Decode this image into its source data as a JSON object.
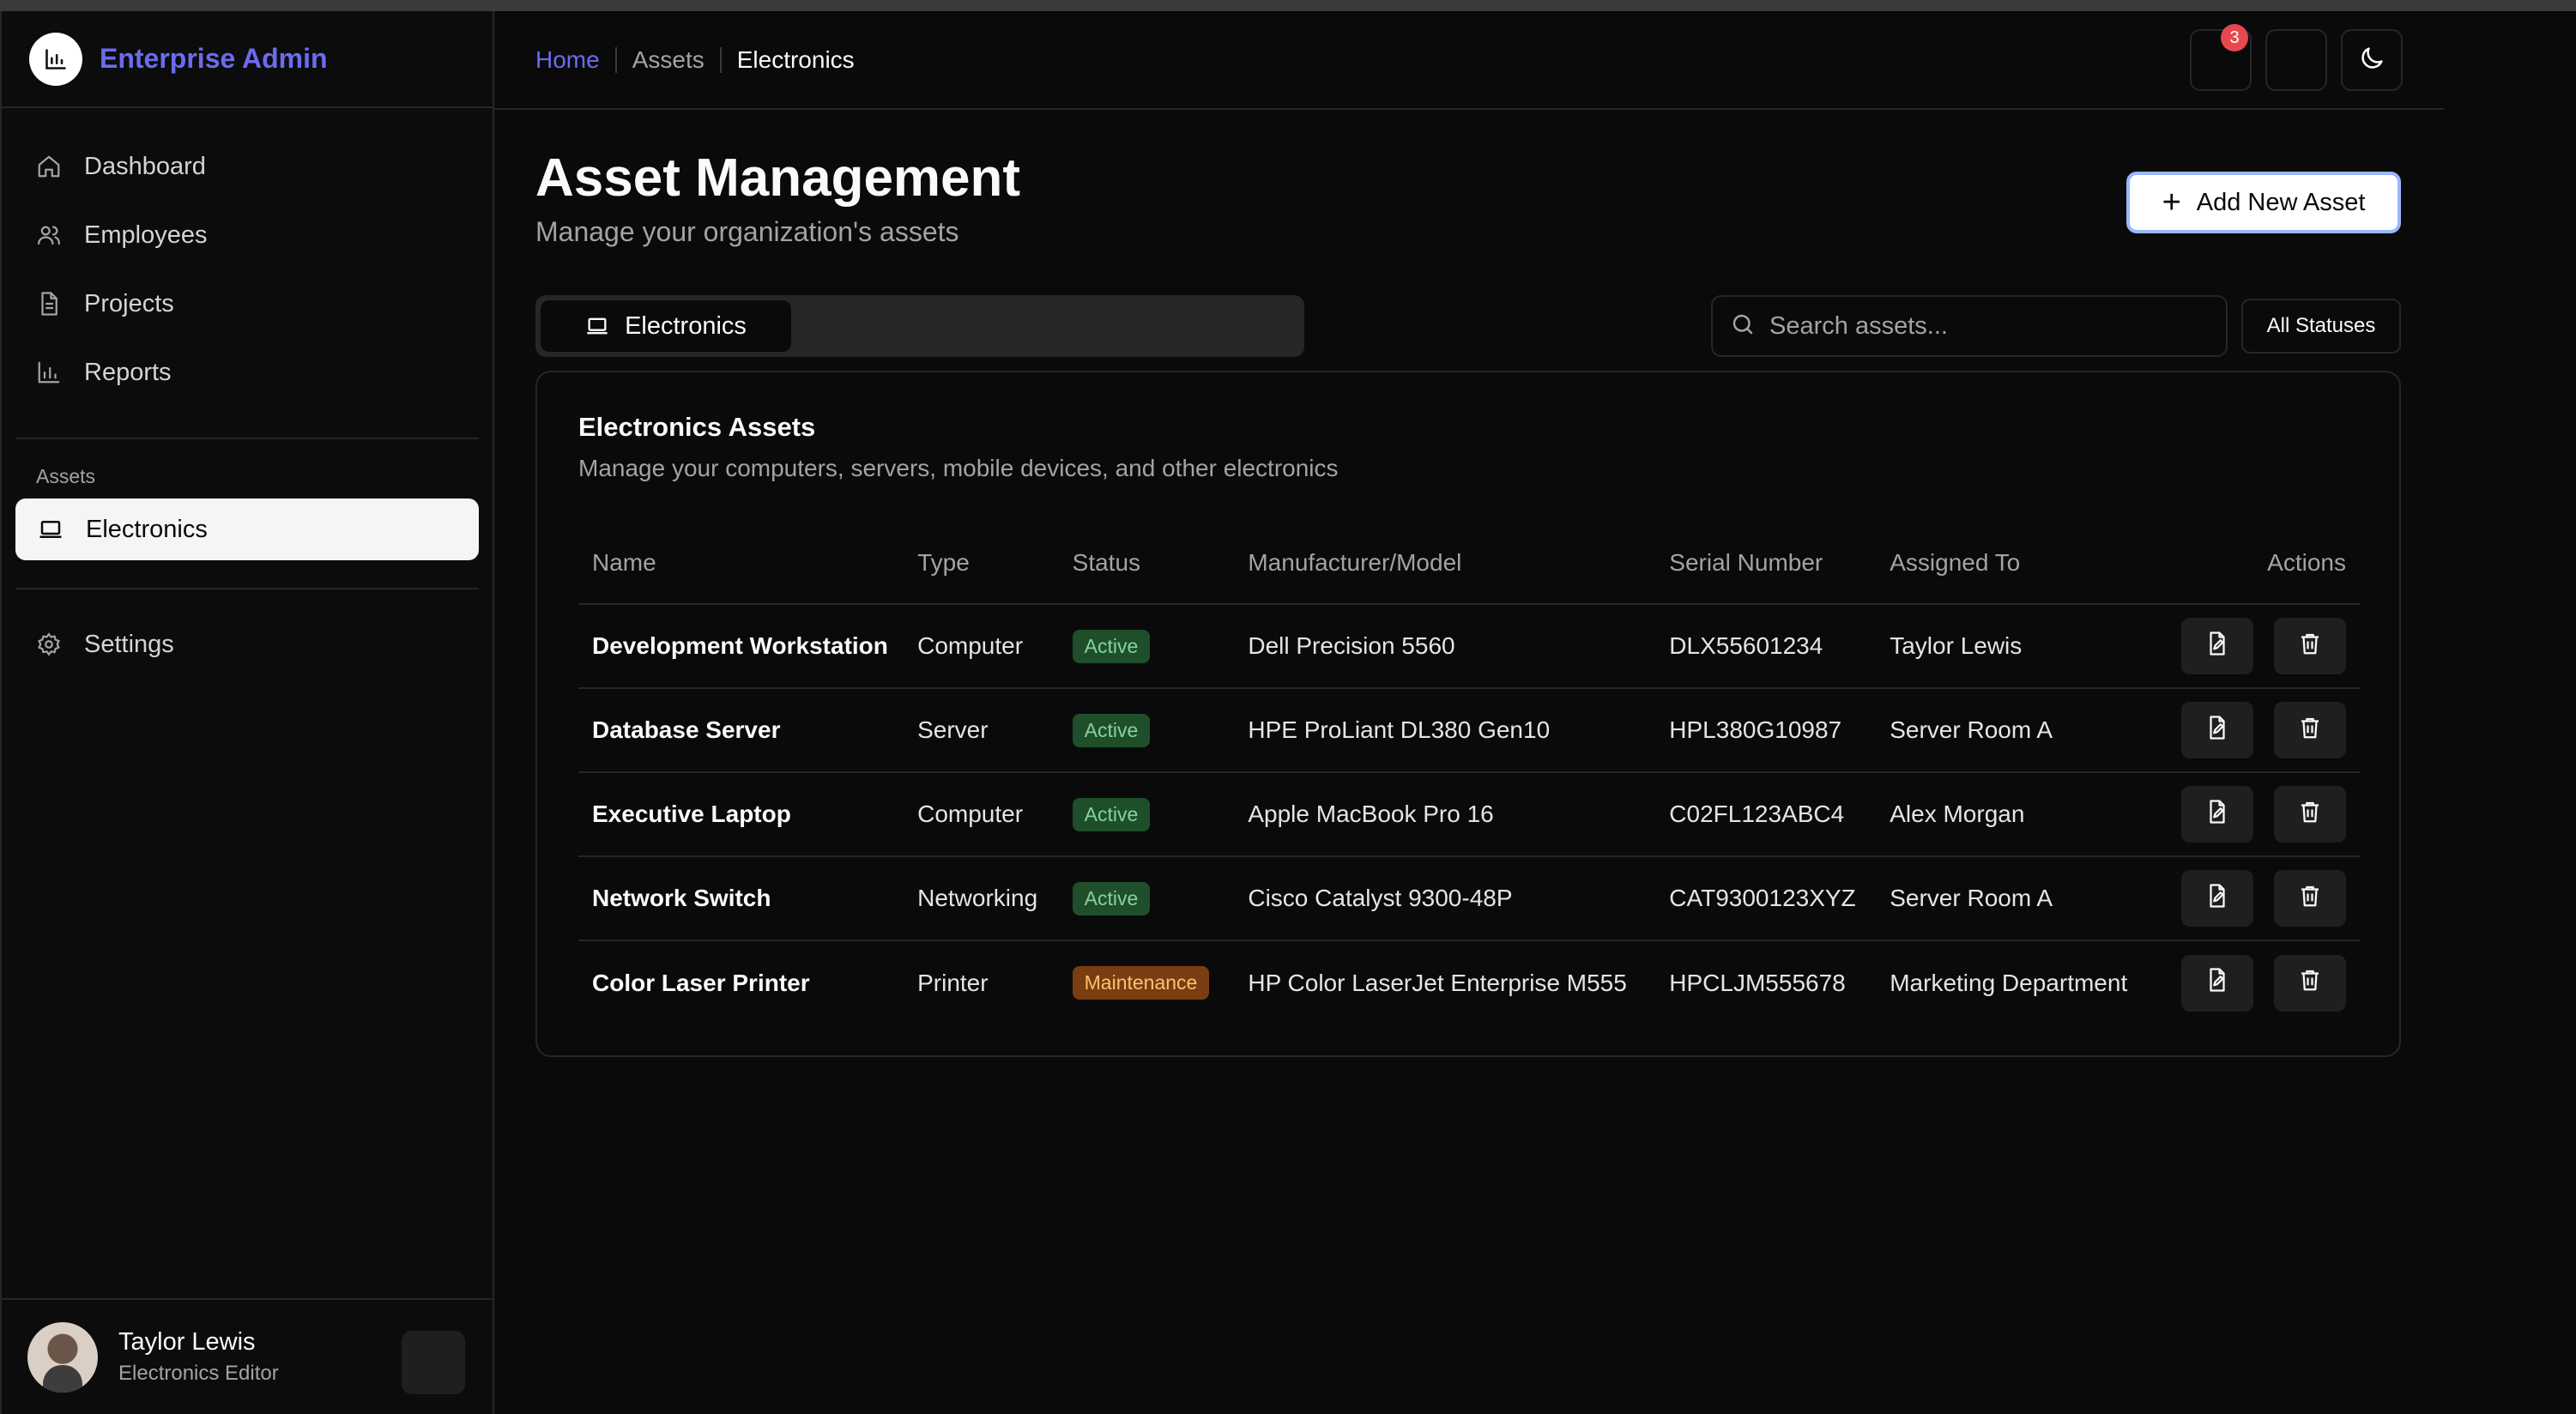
{
  "brand": {
    "name": "Enterprise Admin"
  },
  "sidebar": {
    "items": [
      {
        "label": "Dashboard",
        "icon": "home-icon"
      },
      {
        "label": "Employees",
        "icon": "users-icon"
      },
      {
        "label": "Projects",
        "icon": "file-icon"
      },
      {
        "label": "Reports",
        "icon": "bar-chart-icon"
      }
    ],
    "group_label": "Assets",
    "asset_item": {
      "label": "Electronics",
      "icon": "laptop-icon",
      "active": true
    },
    "settings": {
      "label": "Settings",
      "icon": "gear-icon"
    }
  },
  "user": {
    "name": "Taylor Lewis",
    "role": "Electronics Editor"
  },
  "header": {
    "breadcrumb": [
      "Home",
      "Assets",
      "Electronics"
    ],
    "notification_count": "3"
  },
  "main": {
    "title": "Asset Management",
    "subtitle": "Manage your organization's assets",
    "add_button": "Add New Asset",
    "tabs": [
      {
        "label": "Electronics",
        "icon": "laptop-icon"
      }
    ],
    "search_placeholder": "Search assets...",
    "status_filter": "All Statuses"
  },
  "card": {
    "title": "Electronics Assets",
    "description": "Manage your computers, servers, mobile devices, and other electronics"
  },
  "table": {
    "headers": [
      "Name",
      "Type",
      "Status",
      "Manufacturer/Model",
      "Serial Number",
      "Assigned To",
      "Actions"
    ],
    "rows": [
      {
        "name": "Development Workstation",
        "type": "Computer",
        "status": "Active",
        "model": "Dell Precision 5560",
        "serial": "DLX55601234",
        "assigned": "Taylor Lewis"
      },
      {
        "name": "Database Server",
        "type": "Server",
        "status": "Active",
        "model": "HPE ProLiant DL380 Gen10",
        "serial": "HPL380G10987",
        "assigned": "Server Room A"
      },
      {
        "name": "Executive Laptop",
        "type": "Computer",
        "status": "Active",
        "model": "Apple MacBook Pro 16",
        "serial": "C02FL123ABC4",
        "assigned": "Alex Morgan"
      },
      {
        "name": "Network Switch",
        "type": "Networking",
        "status": "Active",
        "model": "Cisco Catalyst 9300-48P",
        "serial": "CAT9300123XYZ",
        "assigned": "Server Room A"
      },
      {
        "name": "Color Laser Printer",
        "type": "Printer",
        "status": "Maintenance",
        "model": "HP Color LaserJet Enterprise M555",
        "serial": "HPCLJM555678",
        "assigned": "Marketing Department"
      }
    ]
  },
  "colors": {
    "accent": "#6b6bf0",
    "active_bg": "#1e4f2a",
    "maintenance_bg": "#7a3d12",
    "badge": "#e5484d"
  }
}
